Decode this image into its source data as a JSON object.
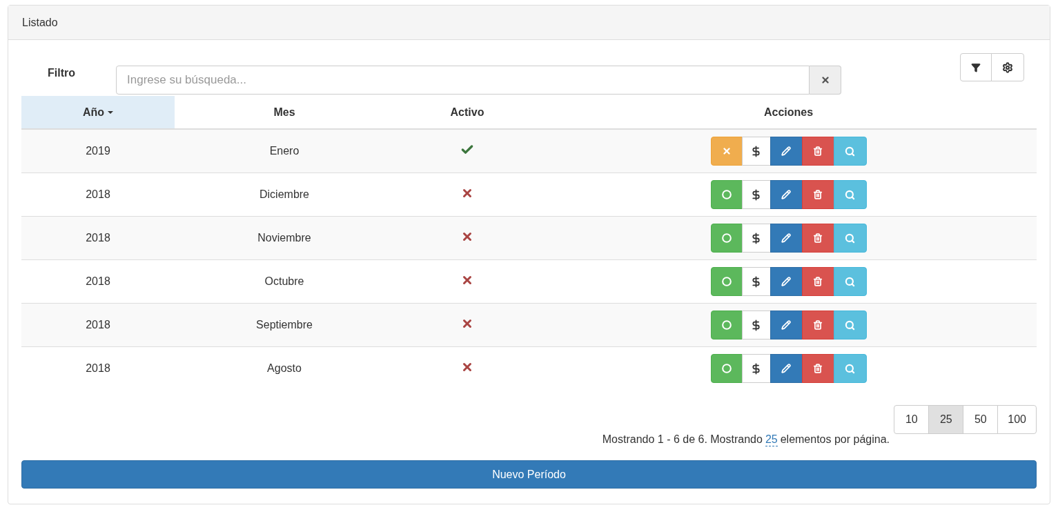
{
  "panel": {
    "title": "Listado"
  },
  "filter": {
    "label": "Filtro",
    "placeholder": "Ingrese su búsqueda..."
  },
  "table": {
    "columns": [
      {
        "label": "Año",
        "sorted": true
      },
      {
        "label": "Mes",
        "sorted": false
      },
      {
        "label": "Activo",
        "sorted": false
      },
      {
        "label": "Acciones",
        "sorted": false
      }
    ],
    "rows": [
      {
        "year": "2019",
        "month": "Enero",
        "active": true
      },
      {
        "year": "2018",
        "month": "Diciembre",
        "active": false
      },
      {
        "year": "2018",
        "month": "Noviembre",
        "active": false
      },
      {
        "year": "2018",
        "month": "Octubre",
        "active": false
      },
      {
        "year": "2018",
        "month": "Septiembre",
        "active": false
      },
      {
        "year": "2018",
        "month": "Agosto",
        "active": false
      }
    ]
  },
  "page_sizes": [
    {
      "label": "10",
      "selected": false
    },
    {
      "label": "25",
      "selected": true
    },
    {
      "label": "50",
      "selected": false
    },
    {
      "label": "100",
      "selected": false
    }
  ],
  "summary": {
    "before": "Mostrando 1 - 6 de 6. Mostrando",
    "link": "25",
    "after": "elementos por página."
  },
  "new_button": "Nuevo Período"
}
